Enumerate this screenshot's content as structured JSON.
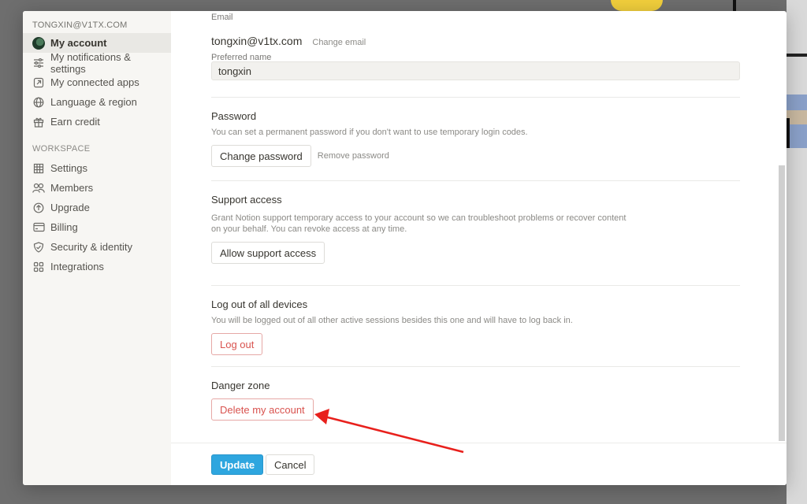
{
  "sidebar": {
    "account_email": "TONGXIN@V1TX.COM",
    "account_items": [
      {
        "label": "My account",
        "icon": "avatar"
      },
      {
        "label": "My notifications & settings",
        "icon": "sliders-icon"
      },
      {
        "label": "My connected apps",
        "icon": "external-link-icon"
      },
      {
        "label": "Language & region",
        "icon": "globe-icon"
      },
      {
        "label": "Earn credit",
        "icon": "gift-icon"
      }
    ],
    "workspace_header": "WORKSPACE",
    "workspace_items": [
      {
        "label": "Settings",
        "icon": "building-icon"
      },
      {
        "label": "Members",
        "icon": "people-icon"
      },
      {
        "label": "Upgrade",
        "icon": "upgrade-arrow-icon"
      },
      {
        "label": "Billing",
        "icon": "credit-card-icon"
      },
      {
        "label": "Security & identity",
        "icon": "shield-icon"
      },
      {
        "label": "Integrations",
        "icon": "grid-icon"
      }
    ]
  },
  "account": {
    "email_label": "Email",
    "email_value": "tongxin@v1tx.com",
    "change_email": "Change email",
    "preferred_name_label": "Preferred name",
    "preferred_name_value": "tongxin"
  },
  "password": {
    "title": "Password",
    "description": "You can set a permanent password if you don't want to use temporary login codes.",
    "change_button": "Change password",
    "remove_link": "Remove password"
  },
  "support": {
    "title": "Support access",
    "description": "Grant Notion support temporary access to your account so we can troubleshoot problems or recover content on your behalf. You can revoke access at any time.",
    "button": "Allow support access"
  },
  "logout_all": {
    "title": "Log out of all devices",
    "description": "You will be logged out of all other active sessions besides this one and will have to log back in.",
    "button": "Log out"
  },
  "danger": {
    "title": "Danger zone",
    "button": "Delete my account"
  },
  "footer": {
    "update": "Update",
    "cancel": "Cancel"
  },
  "colors": {
    "accent": "#2ea6df",
    "danger": "#d9534f",
    "annotation_arrow": "#e8201c"
  }
}
